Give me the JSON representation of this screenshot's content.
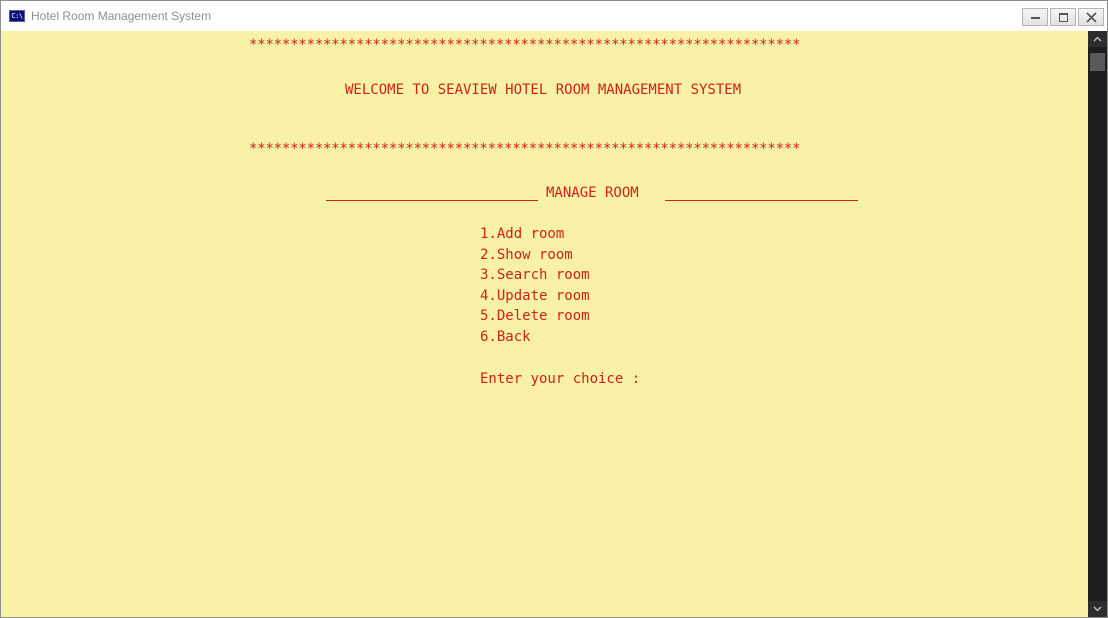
{
  "window": {
    "title": "Hotel Room Management System",
    "icon_text": "C:\\"
  },
  "console": {
    "stars_top": "*******************************************************************",
    "welcome": "WELCOME TO SEAVIEW HOTEL ROOM MANAGEMENT SYSTEM",
    "stars_bottom": "*******************************************************************",
    "section_title": "MANAGE ROOM",
    "menu": [
      "1.Add room",
      "2.Show room",
      "3.Search room",
      "4.Update room",
      "5.Delete room",
      "6.Back"
    ],
    "prompt": "Enter your choice :"
  },
  "colors": {
    "background": "#f9f1a5",
    "text": "#d0211c",
    "scrollbar": "#1e1e1e"
  },
  "icons": {
    "app": "console-app-icon",
    "minimize": "minimize-icon",
    "maximize": "maximize-icon",
    "close": "close-icon",
    "scroll_up": "chevron-up-icon",
    "scroll_down": "chevron-down-icon"
  }
}
